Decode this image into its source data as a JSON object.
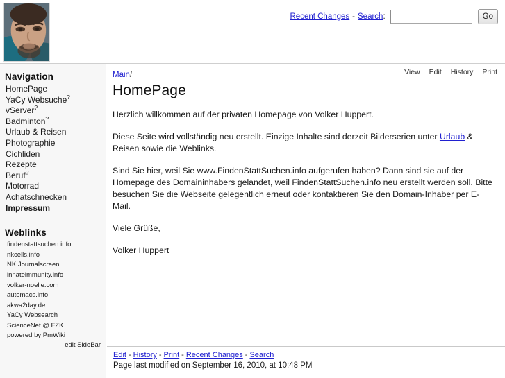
{
  "header": {
    "photo_alt": "portrait-photo",
    "recent_changes_label": "Recent Changes",
    "separator": "-",
    "search_label": "Search",
    "colon": ":",
    "search_value": "",
    "search_placeholder": "",
    "go_label": "Go"
  },
  "sidebar": {
    "nav_heading": "Navigation",
    "nav_items": [
      {
        "label": "HomePage",
        "marker": "",
        "bold": false
      },
      {
        "label": "YaCy Websuche",
        "marker": "?",
        "bold": false
      },
      {
        "label": "vServer",
        "marker": "?",
        "bold": false
      },
      {
        "label": "Badminton",
        "marker": "?",
        "bold": false
      },
      {
        "label": "Urlaub & Reisen",
        "marker": "",
        "bold": false
      },
      {
        "label": "Photographie",
        "marker": "",
        "bold": false
      },
      {
        "label": "Cichliden",
        "marker": "",
        "bold": false
      },
      {
        "label": "Rezepte",
        "marker": "",
        "bold": false
      },
      {
        "label": "Beruf",
        "marker": "?",
        "bold": false
      },
      {
        "label": "Motorrad",
        "marker": "",
        "bold": false
      },
      {
        "label": "Achatschnecken",
        "marker": "",
        "bold": false
      },
      {
        "label": "Impressum",
        "marker": "",
        "bold": true
      }
    ],
    "links_heading": "Weblinks",
    "links": [
      "findenstattsuchen.info",
      "nkcells.info",
      "NK Journalscreen",
      "innateimmunity.info",
      "volker-noelle.com",
      "automacs.info",
      "akwa2day.de",
      "YaCy Websearch",
      "ScienceNet @ FZK",
      "powered by PmWiki"
    ],
    "edit_sidebar_label": "edit SideBar"
  },
  "main": {
    "actions": [
      "View",
      "Edit",
      "History",
      "Print"
    ],
    "breadcrumb_link": "Main",
    "breadcrumb_slash": "/",
    "title": "HomePage",
    "paragraphs": [
      "Herzlich willkommen auf der privaten Homepage von Volker Huppert.",
      "Diese Seite wird vollständig neu erstellt. Einzige Inhalte sind derzeit Bilderserien unter ",
      "Sind Sie hier, weil Sie www.FindenStattSuchen.info aufgerufen haben? Dann sind sie auf der Homepage des Domaininhabers gelandet, weil FindenStattSuchen.info neu erstellt werden soll. Bitte besuchen Sie die Webseite gelegentlich erneut oder kontaktieren Sie den Domain-Inhaber per E-Mail.",
      "Viele Grüße,",
      "Volker Huppert"
    ],
    "para2_link": "Urlaub",
    "para2_tail": " & Reisen sowie die Weblinks."
  },
  "footer": {
    "links": [
      "Edit",
      "History",
      "Print",
      "Recent Changes",
      "Search"
    ],
    "separator": "-",
    "modified": "Page last modified on September 16, 2010, at 10:48 PM"
  },
  "colors": {
    "link": "#2020d0",
    "sidebar_bg": "#f7f7f7",
    "border": "#c9c9c9",
    "text": "#1a1a1a"
  }
}
